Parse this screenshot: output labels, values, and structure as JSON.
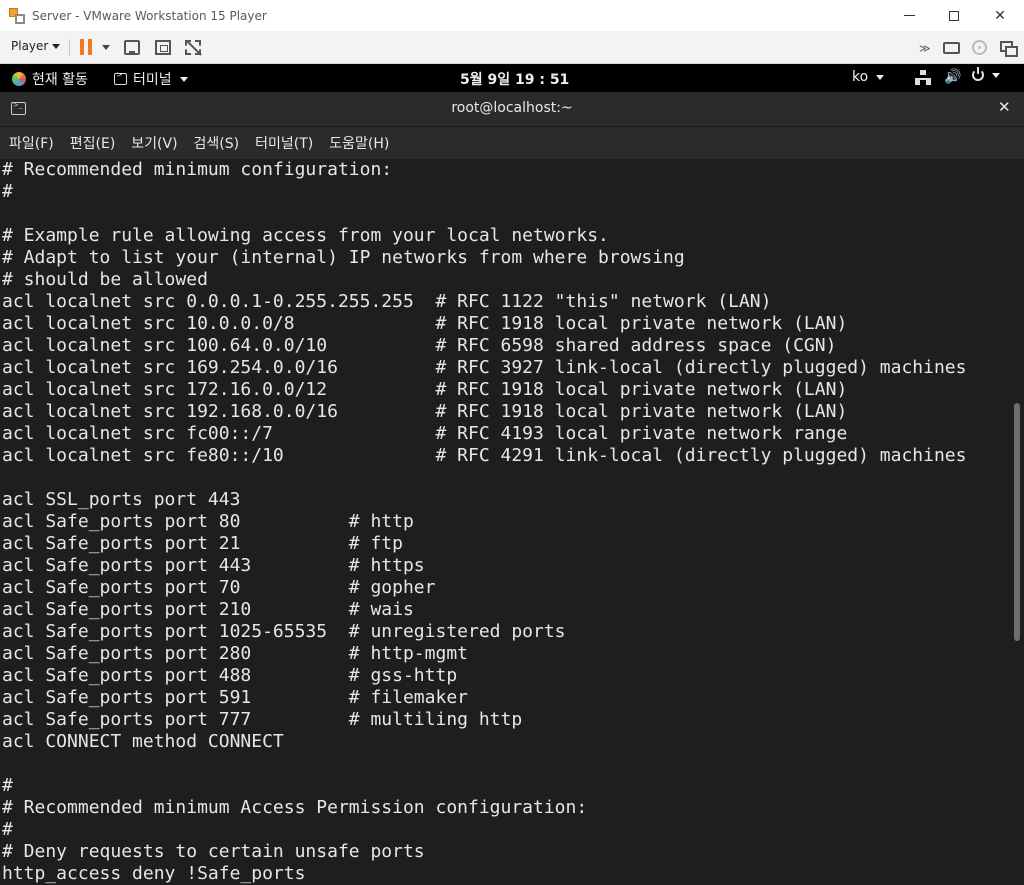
{
  "vmware": {
    "title": "Server - VMware Workstation 15 Player",
    "player_menu": "Player",
    "icons": [
      "vmware-logo-icon",
      "pause-icon",
      "send-ctrl-alt-del-icon",
      "fullscreen-icon",
      "unity-icon",
      "more-icon",
      "disk-icon",
      "cd-icon",
      "network-icon"
    ]
  },
  "gnome": {
    "activities": "현재 활동",
    "app_menu": "터미널",
    "clock": "5월 9일  19 : 51",
    "lang": "ko"
  },
  "terminal": {
    "title": "root@localhost:~",
    "menu": [
      "파일(F)",
      "편집(E)",
      "보기(V)",
      "검색(S)",
      "터미널(T)",
      "도움말(H)"
    ],
    "lines": [
      "# Recommended minimum configuration:",
      "#",
      "",
      "# Example rule allowing access from your local networks.",
      "# Adapt to list your (internal) IP networks from where browsing",
      "# should be allowed",
      "acl localnet src 0.0.0.1-0.255.255.255  # RFC 1122 \"this\" network (LAN)",
      "acl localnet src 10.0.0.0/8             # RFC 1918 local private network (LAN)",
      "acl localnet src 100.64.0.0/10          # RFC 6598 shared address space (CGN)",
      "acl localnet src 169.254.0.0/16         # RFC 3927 link-local (directly plugged) machines",
      "acl localnet src 172.16.0.0/12          # RFC 1918 local private network (LAN)",
      "acl localnet src 192.168.0.0/16         # RFC 1918 local private network (LAN)",
      "acl localnet src fc00::/7               # RFC 4193 local private network range",
      "acl localnet src fe80::/10              # RFC 4291 link-local (directly plugged) machines",
      "",
      "acl SSL_ports port 443",
      "acl Safe_ports port 80          # http",
      "acl Safe_ports port 21          # ftp",
      "acl Safe_ports port 443         # https",
      "acl Safe_ports port 70          # gopher",
      "acl Safe_ports port 210         # wais",
      "acl Safe_ports port 1025-65535  # unregistered ports",
      "acl Safe_ports port 280         # http-mgmt",
      "acl Safe_ports port 488         # gss-http",
      "acl Safe_ports port 591         # filemaker",
      "acl Safe_ports port 777         # multiling http",
      "acl CONNECT method CONNECT",
      "",
      "#",
      "# Recommended minimum Access Permission configuration:",
      "#",
      "# Deny requests to certain unsafe ports",
      "http_access deny !Safe_ports"
    ]
  }
}
